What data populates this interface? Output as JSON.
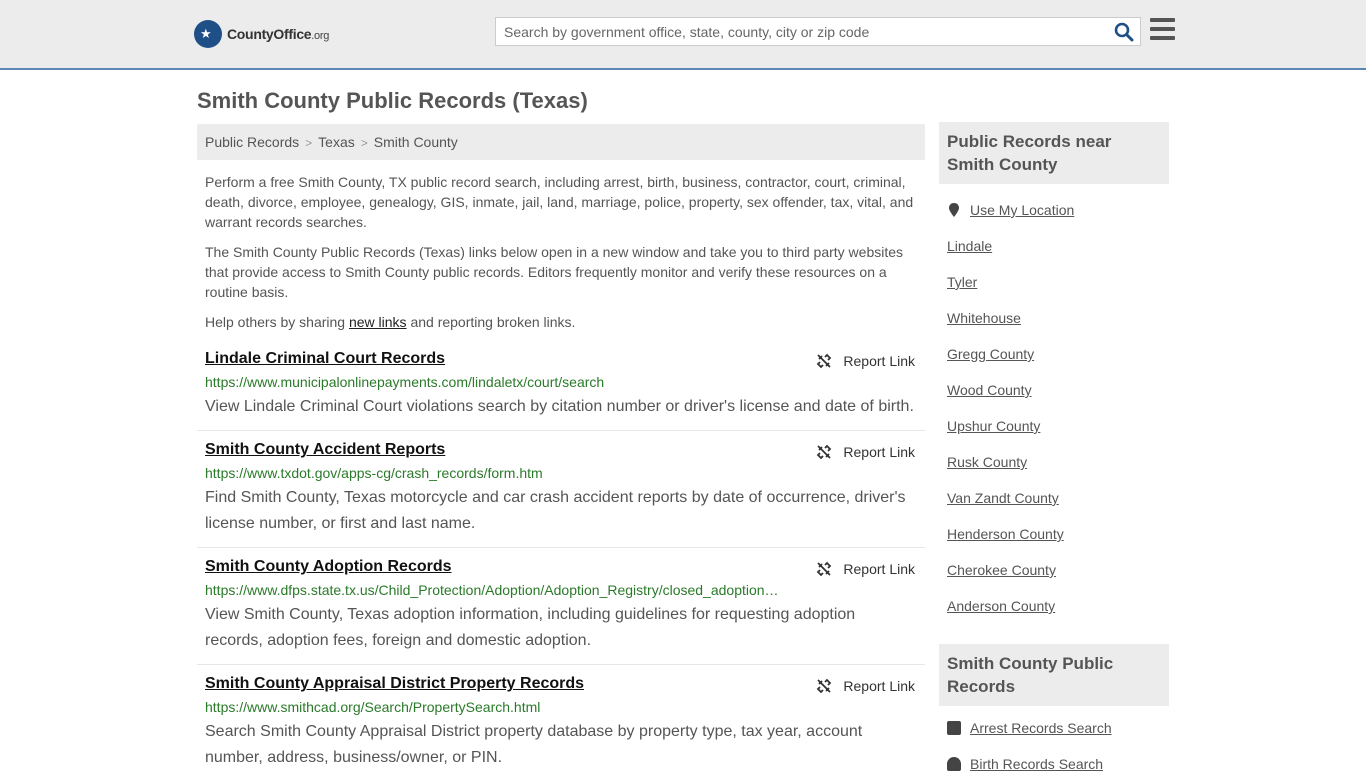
{
  "header": {
    "logo_name": "CountyOffice",
    "logo_tld": ".org",
    "search_placeholder": "Search by government office, state, county, city or zip code"
  },
  "page_title": "Smith County Public Records (Texas)",
  "breadcrumb": [
    "Public Records",
    "Texas",
    "Smith County"
  ],
  "intro": {
    "p1": "Perform a free Smith County, TX public record search, including arrest, birth, business, contractor, court, criminal, death, divorce, employee, genealogy, GIS, inmate, jail, land, marriage, police, property, sex offender, tax, vital, and warrant records searches.",
    "p2": "The Smith County Public Records (Texas) links below open in a new window and take you to third party websites that provide access to Smith County public records. Editors frequently monitor and verify these resources on a routine basis.",
    "p3_before": "Help others by sharing ",
    "p3_link": "new links",
    "p3_after": " and reporting broken links."
  },
  "report_label": "Report Link",
  "records": [
    {
      "title": "Lindale Criminal Court Records",
      "url": "https://www.municipalonlinepayments.com/lindaletx/court/search",
      "desc": "View Lindale Criminal Court violations search by citation number or driver's license and date of birth."
    },
    {
      "title": "Smith County Accident Reports",
      "url": "https://www.txdot.gov/apps-cg/crash_records/form.htm",
      "desc": "Find Smith County, Texas motorcycle and car crash accident reports by date of occurrence, driver's license number, or first and last name."
    },
    {
      "title": "Smith County Adoption Records",
      "url": "https://www.dfps.state.tx.us/Child_Protection/Adoption/Adoption_Registry/closed_adoption…",
      "desc": "View Smith County, Texas adoption information, including guidelines for requesting adoption records, adoption fees, foreign and domestic adoption."
    },
    {
      "title": "Smith County Appraisal District Property Records",
      "url": "https://www.smithcad.org/Search/PropertySearch.html",
      "desc": "Search Smith County Appraisal District property database by property type, tax year, account number, address, business/owner, or PIN."
    }
  ],
  "sidebar": {
    "nearby_heading": "Public Records near Smith County",
    "use_location": "Use My Location",
    "nearby": [
      "Lindale",
      "Tyler",
      "Whitehouse",
      "Gregg County",
      "Wood County",
      "Upshur County",
      "Rusk County",
      "Van Zandt County",
      "Henderson County",
      "Cherokee County",
      "Anderson County"
    ],
    "records_heading": "Smith County Public Records",
    "records_links": [
      "Arrest Records Search",
      "Birth Records Search"
    ]
  },
  "colors": {
    "accent_blue": "#1e4f87",
    "url_green": "#2a7a2a",
    "panel_gray": "#ececec"
  }
}
